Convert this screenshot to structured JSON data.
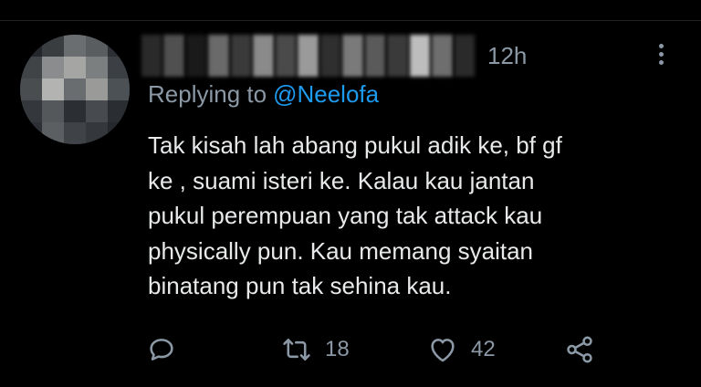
{
  "tweet": {
    "author_name": "",
    "timestamp": "12h",
    "replying_prefix": "Replying to",
    "replying_handle": "@Neelofa",
    "text_lines": [
      "Tak kisah lah abang pukul adik ke, bf gf",
      "ke , suami isteri ke. Kalau kau jantan",
      "pukul perempuan yang tak attack kau",
      "physically pun. Kau memang syaitan",
      "binatang pun tak sehina kau."
    ]
  },
  "actions": {
    "reply_icon": "reply-icon",
    "retweet_icon": "retweet-icon",
    "retweet_count": "18",
    "like_icon": "heart-icon",
    "like_count": "42",
    "share_icon": "share-icon"
  },
  "colors": {
    "background": "#000000",
    "text": "#e7e9ea",
    "secondary": "#8b98a5",
    "link": "#1d9bf0"
  }
}
